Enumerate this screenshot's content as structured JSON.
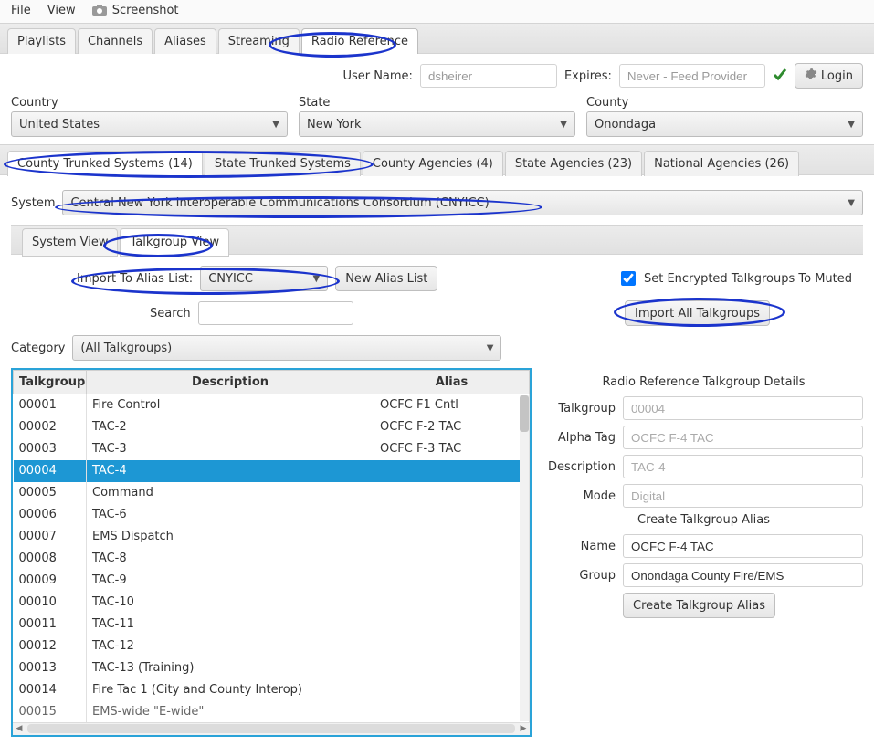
{
  "menubar": {
    "file": "File",
    "view": "View",
    "screenshot": "Screenshot"
  },
  "tabs": {
    "items": [
      "Playlists",
      "Channels",
      "Aliases",
      "Streaming",
      "Radio Reference"
    ],
    "active": 4
  },
  "user": {
    "username_label": "User Name:",
    "username_value": "dsheirer",
    "expires_label": "Expires:",
    "expires_value": "Never - Feed Provider",
    "login_label": "Login"
  },
  "geo": {
    "country_label": "Country",
    "country_value": "United States",
    "state_label": "State",
    "state_value": "New York",
    "county_label": "County",
    "county_value": "Onondaga"
  },
  "subTabs": {
    "items": [
      "County Trunked Systems (14)",
      "State Trunked Systems",
      "County Agencies (4)",
      "State Agencies (23)",
      "National Agencies (26)"
    ],
    "active": 0
  },
  "system": {
    "label": "System",
    "value": "Central New York Interoperable Communications Consortium (CNYICC)"
  },
  "viewTabs": {
    "items": [
      "System View",
      "Talkgroup View"
    ],
    "active": 1
  },
  "import": {
    "label": "Import To Alias List:",
    "alias_list": "CNYICC",
    "new_list_btn": "New Alias List",
    "set_encrypted_label": "Set Encrypted Talkgroups To Muted",
    "import_all_btn": "Import All Talkgroups"
  },
  "search": {
    "label": "Search",
    "value": ""
  },
  "category": {
    "label": "Category",
    "value": "(All Talkgroups)"
  },
  "table": {
    "columns": [
      "Talkgroup",
      "Description",
      "Alias"
    ],
    "selectedIndex": 3,
    "rows": [
      {
        "tg": "00001",
        "desc": "Fire Control",
        "alias": "OCFC F1 Cntl"
      },
      {
        "tg": "00002",
        "desc": "TAC-2",
        "alias": "OCFC F-2 TAC"
      },
      {
        "tg": "00003",
        "desc": "TAC-3",
        "alias": "OCFC F-3 TAC"
      },
      {
        "tg": "00004",
        "desc": "TAC-4",
        "alias": ""
      },
      {
        "tg": "00005",
        "desc": "Command",
        "alias": ""
      },
      {
        "tg": "00006",
        "desc": "TAC-6",
        "alias": ""
      },
      {
        "tg": "00007",
        "desc": "EMS Dispatch",
        "alias": ""
      },
      {
        "tg": "00008",
        "desc": "TAC-8",
        "alias": ""
      },
      {
        "tg": "00009",
        "desc": "TAC-9",
        "alias": ""
      },
      {
        "tg": "00010",
        "desc": "TAC-10",
        "alias": ""
      },
      {
        "tg": "00011",
        "desc": "TAC-11",
        "alias": ""
      },
      {
        "tg": "00012",
        "desc": "TAC-12",
        "alias": ""
      },
      {
        "tg": "00013",
        "desc": "TAC-13 (Training)",
        "alias": ""
      },
      {
        "tg": "00014",
        "desc": "Fire Tac 1 (City and County Interop)",
        "alias": ""
      },
      {
        "tg": "00015",
        "desc": "EMS-wide \"E-wide\"",
        "alias": ""
      }
    ]
  },
  "details": {
    "title": "Radio Reference Talkgroup Details",
    "talkgroup_label": "Talkgroup",
    "talkgroup_value": "00004",
    "alphatag_label": "Alpha Tag",
    "alphatag_value": "OCFC F-4 TAC",
    "description_label": "Description",
    "description_value": "TAC-4",
    "mode_label": "Mode",
    "mode_value": "Digital",
    "create_title": "Create Talkgroup Alias",
    "name_label": "Name",
    "name_value": "OCFC F-4 TAC",
    "group_label": "Group",
    "group_value": "Onondaga County Fire/EMS",
    "create_btn": "Create Talkgroup Alias"
  }
}
